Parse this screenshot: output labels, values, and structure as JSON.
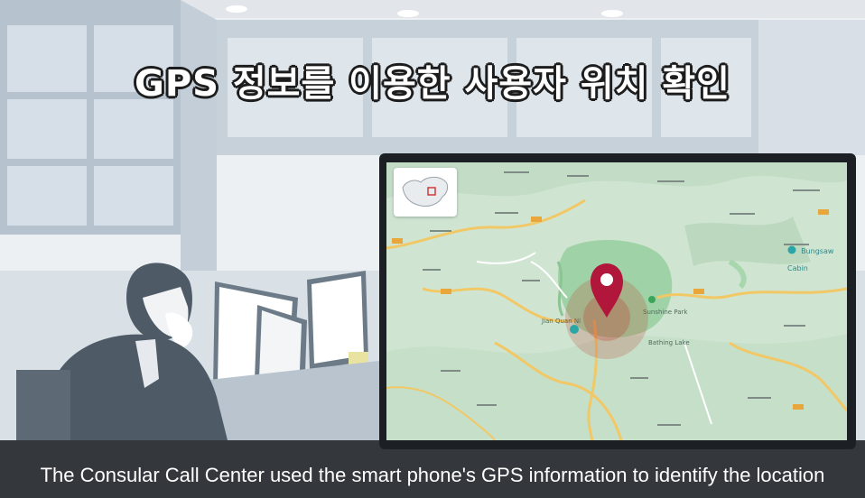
{
  "title": "GPS 정보를 이용한 사용자 위치 확인",
  "subtitle": "The Consular Call Center used the smart phone's GPS information to identify the location",
  "map": {
    "location_marker_icon": "map-pin-icon",
    "poi_icon": "map-poi-icon",
    "poi_label": "Bungsaw Cabin",
    "place_labels": [
      "Jian Quan Ni",
      "Bathing Lake",
      "Sunshine Park"
    ]
  },
  "colors": {
    "pin": "#b0173a",
    "accuracy_radius": "#c0392b",
    "map_land": "#cfe5d2",
    "road": "#f2c866",
    "subtitle_bar": "#1c2024"
  }
}
